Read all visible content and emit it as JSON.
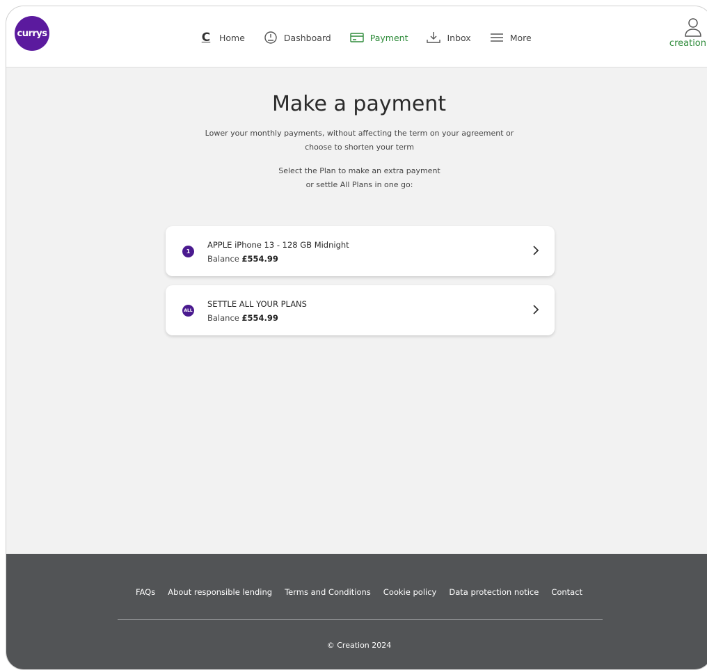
{
  "header": {
    "logo_text": "currys",
    "brand_text": "creation",
    "nav": [
      {
        "label": "Home",
        "icon": "home-c-icon"
      },
      {
        "label": "Dashboard",
        "icon": "gauge-icon"
      },
      {
        "label": "Payment",
        "icon": "card-icon"
      },
      {
        "label": "Inbox",
        "icon": "inbox-icon"
      },
      {
        "label": "More",
        "icon": "menu-icon"
      }
    ],
    "active_nav": "Payment",
    "accent_color": "#2e8b3a",
    "logo_color": "#5b1a9e"
  },
  "main": {
    "title": "Make a payment",
    "subtitle_line1": "Lower your monthly payments, without affecting the term on your agreement or",
    "subtitle_line2": "choose to shorten your term",
    "select_line1": "Select the Plan to make an extra payment",
    "select_line2": "or settle All Plans in one go:",
    "plans": [
      {
        "badge": "1",
        "name": "APPLE iPhone 13 - 128 GB Midnight",
        "balance_label": "Balance",
        "balance_value": "£554.99"
      },
      {
        "badge": "ALL",
        "name": "SETTLE ALL YOUR PLANS",
        "balance_label": "Balance",
        "balance_value": "£554.99"
      }
    ]
  },
  "footer": {
    "links": [
      "FAQs",
      "About responsible lending",
      "Terms and Conditions",
      "Cookie policy",
      "Data protection notice",
      "Contact"
    ],
    "copyright": "© Creation 2024"
  }
}
